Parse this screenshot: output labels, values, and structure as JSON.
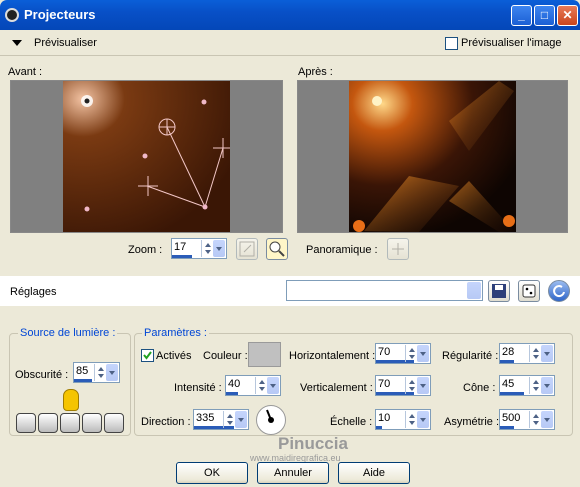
{
  "window": {
    "title": "Projecteurs",
    "min": "_",
    "max": "□",
    "close": "✕"
  },
  "preview_bar": {
    "label": "Prévisualiser",
    "preview_image_label": "Prévisualiser l'image"
  },
  "before": {
    "label": "Avant :"
  },
  "after": {
    "label": "Après :"
  },
  "zoom": {
    "label": "Zoom :",
    "value": "17"
  },
  "panoramique": {
    "label": "Panoramique :"
  },
  "reglages": {
    "label": "Réglages",
    "value": ""
  },
  "source": {
    "title": "Source de lumière :",
    "obscurite_label": "Obscurité :",
    "obscurite_value": "85"
  },
  "params": {
    "title": "Paramètres :",
    "actives_label": "Activés",
    "couleur_label": "Couleur :",
    "couleur_value": "#c0c0c0",
    "intensite_label": "Intensité :",
    "intensite_value": "40",
    "direction_label": "Direction :",
    "direction_value": "335",
    "horizontalement_label": "Horizontalement :",
    "horizontalement_value": "70",
    "verticalement_label": "Verticalement :",
    "verticalement_value": "70",
    "echelle_label": "Échelle :",
    "echelle_value": "10",
    "regularite_label": "Régularité :",
    "regularite_value": "28",
    "cone_label": "Cône :",
    "cone_value": "45",
    "asymetrie_label": "Asymétrie :",
    "asymetrie_value": "500"
  },
  "buttons": {
    "ok": "OK",
    "cancel": "Annuler",
    "help": "Aide"
  },
  "watermark": {
    "name": "Pinuccia",
    "url": "www.maidireqrafica.eu"
  }
}
